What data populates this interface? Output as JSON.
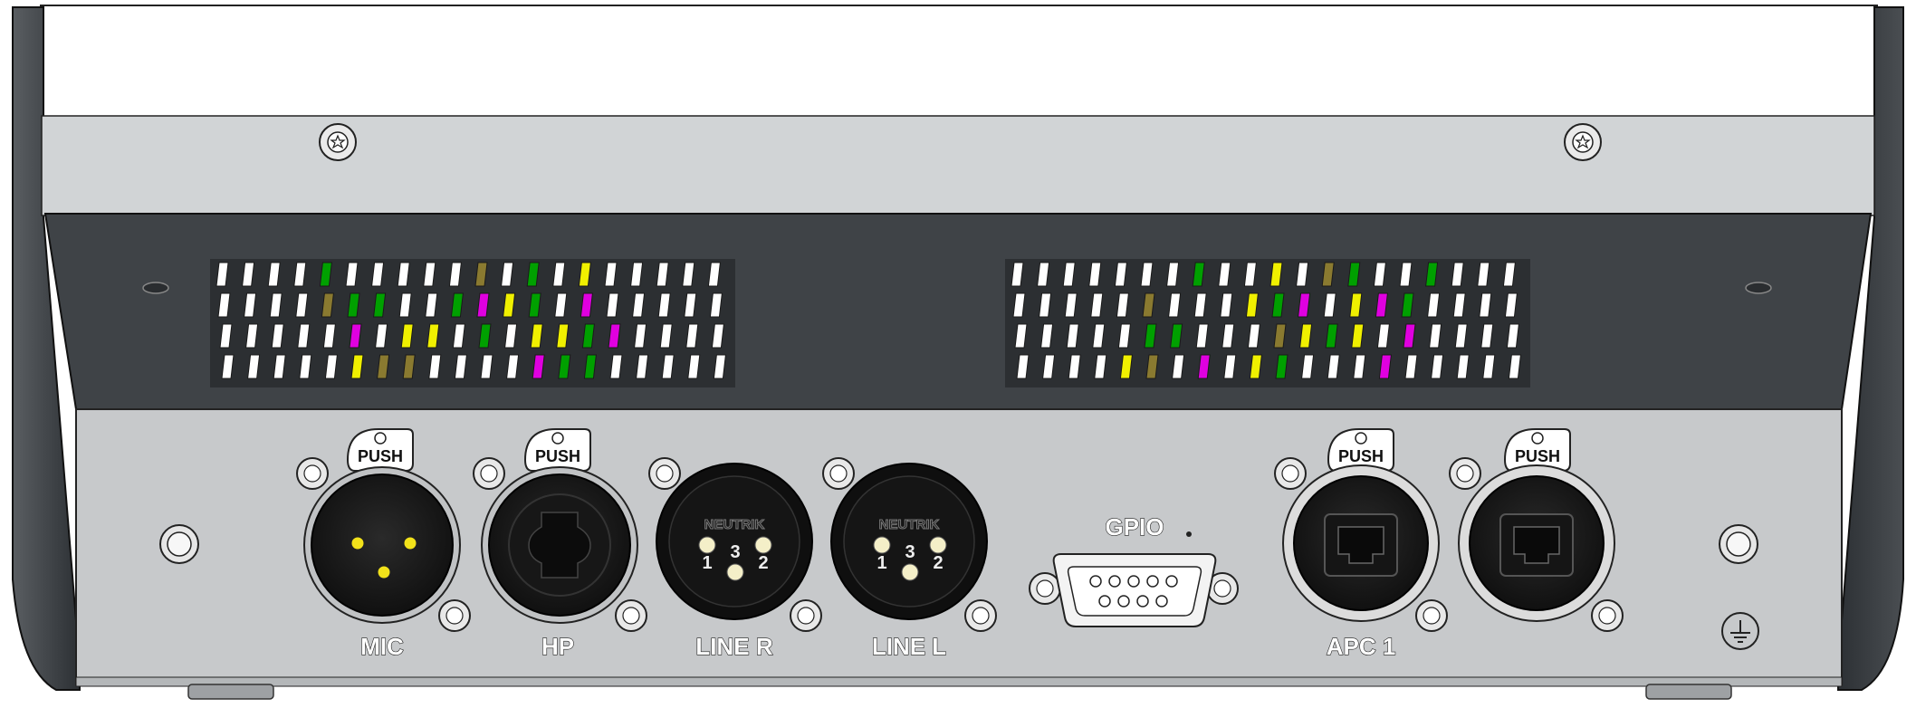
{
  "panel": {
    "push_label": "PUSH",
    "brand_label": "NEUTRIK",
    "gpio_label": "GPIO",
    "pins": {
      "one": "1",
      "two": "2",
      "three": "3"
    },
    "ports": [
      {
        "id": "mic",
        "label": "MIC"
      },
      {
        "id": "hp",
        "label": "HP"
      },
      {
        "id": "line-r",
        "label": "LINE R"
      },
      {
        "id": "line-l",
        "label": "LINE L"
      },
      {
        "id": "apc1",
        "label": "APC 1"
      }
    ]
  },
  "icons": {
    "screw": "screw-icon",
    "ground": "ground-symbol-icon",
    "vent": "vent-grille"
  }
}
